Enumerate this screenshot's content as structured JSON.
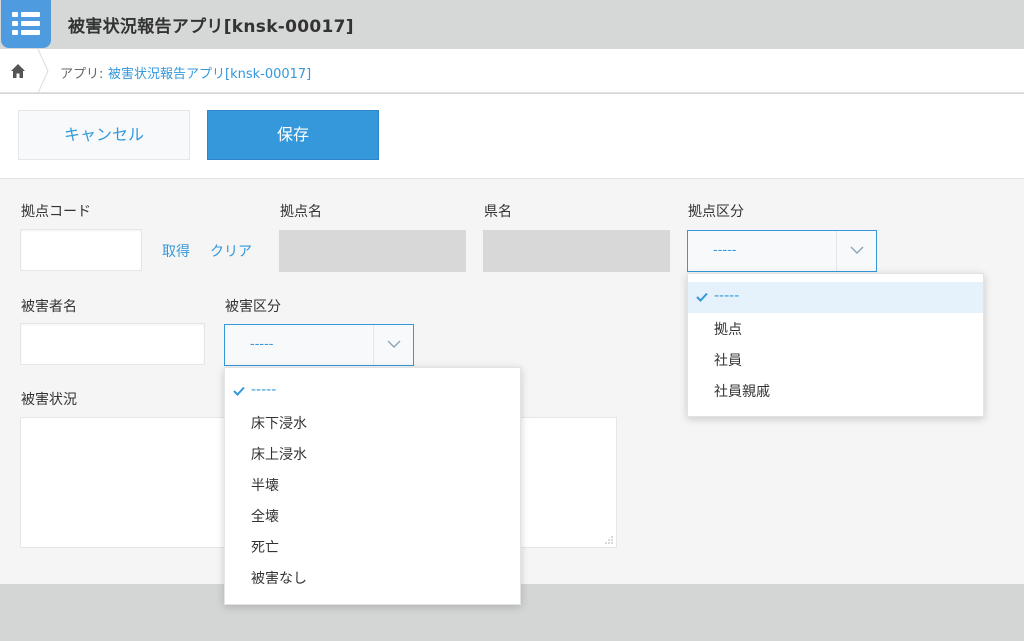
{
  "app": {
    "title": "被害状況報告アプリ[knsk-00017]"
  },
  "breadcrumb": {
    "prefix": "アプリ: ",
    "link": "被害状況報告アプリ[knsk-00017]"
  },
  "toolbar": {
    "cancel_label": "キャンセル",
    "save_label": "保存"
  },
  "form": {
    "base_code": {
      "label": "拠点コード",
      "value": ""
    },
    "fetch_label": "取得",
    "clear_label": "クリア",
    "base_name": {
      "label": "拠点名",
      "value": ""
    },
    "prefecture": {
      "label": "県名",
      "value": ""
    },
    "base_category": {
      "label": "拠点区分",
      "selected": "-----",
      "options": [
        "-----",
        "拠点",
        "社員",
        "社員親戚"
      ]
    },
    "victim_name": {
      "label": "被害者名",
      "value": ""
    },
    "damage_category": {
      "label": "被害区分",
      "selected": "-----",
      "options": [
        "-----",
        "床下浸水",
        "床上浸水",
        "半壊",
        "全壊",
        "死亡",
        "被害なし"
      ]
    },
    "damage_status": {
      "label": "被害状況",
      "value": ""
    }
  },
  "colors": {
    "accent": "#3498db",
    "app_icon": "#4f9be0",
    "header_bg": "#d6d8d8",
    "form_bg": "#f5f5f5",
    "readonly_bg": "#d8d8d8",
    "selected_option_bg": "#e5f1fb"
  },
  "icons": {
    "app": "list-icon",
    "home": "home-icon",
    "select_chevron": "chevron-down-icon",
    "selected_marker": "check-icon",
    "textarea_resize": "resize-handle-icon"
  }
}
